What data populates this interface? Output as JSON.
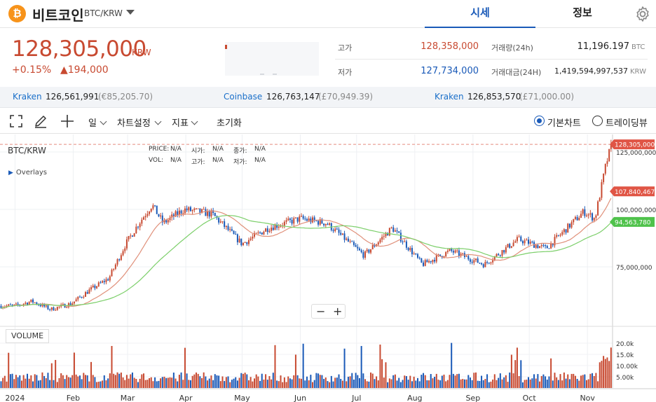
{
  "header": {
    "coin_icon": "₿",
    "coin_name": "비트코인",
    "pair": "BTC/KRW",
    "tabs": [
      {
        "label": "시세",
        "active": true
      },
      {
        "label": "정보",
        "active": false
      }
    ]
  },
  "summary": {
    "price": "128,305,000",
    "unit": "KRW",
    "change_pct": "+0.15%",
    "change_abs": "▲194,000",
    "high_label": "고가",
    "high_value": "128,358,000",
    "low_label": "저가",
    "low_value": "127,734,000",
    "volume_label": "거래량(24h)",
    "volume_value": "11,196.197",
    "volume_unit": "BTC",
    "amount_label": "거래대금(24H)",
    "amount_value": "1,419,594,997,537",
    "amount_unit": "KRW"
  },
  "exchanges": [
    {
      "name": "Kraken",
      "price": "126,561,991",
      "ref": "(€85,205.70)"
    },
    {
      "name": "Coinbase",
      "price": "126,763,147",
      "ref": "(£70,949.39)"
    },
    {
      "name": "Kraken",
      "price": "126,853,570",
      "ref": "(£71,000.00)"
    }
  ],
  "toolbar": {
    "interval": "일",
    "chart_settings": "차트설정",
    "indicators": "지표",
    "reset": "초기화",
    "basic_chart": "기본차트",
    "tradingview": "트레이딩뷰"
  },
  "chart_info": {
    "symbol": "BTC/KRW",
    "overlays": "Overlays",
    "price_lbl": "PRICE:",
    "price_val": "N/A",
    "open_lbl": "시가:",
    "open_val": "N/A",
    "close_lbl": "종가:",
    "close_val": "N/A",
    "vol_lbl": "VOL:",
    "vol_val": "N/A",
    "high_lbl": "고가:",
    "high_val": "N/A",
    "low_lbl": "저가:",
    "low_val": "N/A",
    "zoom_out": "−",
    "zoom_in": "+",
    "volume_title": "VOLUME"
  },
  "colors": {
    "up": "#c84a31",
    "down": "#1a5ab8",
    "ma_short": "#e0907a",
    "ma_long": "#7ccf6a",
    "active_tab": "#1a5ab8"
  },
  "chart_data": {
    "type": "candlestick",
    "series_description": "BTC/KRW daily candles with two moving averages and volume",
    "x_tick_labels": [
      "2024",
      "Feb",
      "Mar",
      "Apr",
      "May",
      "Jun",
      "Jul",
      "Aug",
      "Sep",
      "Oct",
      "Nov"
    ],
    "y_tick_labels": [
      "125,000,000",
      "100,000,000",
      "75,000,000"
    ],
    "ylim": [
      40000000,
      130000000
    ],
    "volume_tick_labels": [
      "20.0k",
      "15.0k",
      "10.00k",
      "5.00k"
    ],
    "volume_ylim": [
      0,
      25000
    ],
    "price_tags": [
      {
        "label": "128,305,000",
        "value": 128305000,
        "color": "#e05545"
      },
      {
        "label": "107,840,467",
        "value": 107840467,
        "color": "#e05545"
      },
      {
        "label": "94,563,780",
        "value": 94563780,
        "color": "#4fc24b"
      }
    ],
    "close_anchors": [
      {
        "date": "2024-01-01",
        "close": 58000000
      },
      {
        "date": "2024-01-10",
        "close": 60000000
      },
      {
        "date": "2024-01-20",
        "close": 56500000
      },
      {
        "date": "2024-01-31",
        "close": 59000000
      },
      {
        "date": "2024-02-10",
        "close": 65000000
      },
      {
        "date": "2024-02-20",
        "close": 70000000
      },
      {
        "date": "2024-02-29",
        "close": 85000000
      },
      {
        "date": "2024-03-07",
        "close": 94000000
      },
      {
        "date": "2024-03-14",
        "close": 102000000
      },
      {
        "date": "2024-03-20",
        "close": 94000000
      },
      {
        "date": "2024-03-31",
        "close": 100000000
      },
      {
        "date": "2024-04-15",
        "close": 98000000
      },
      {
        "date": "2024-05-01",
        "close": 85000000
      },
      {
        "date": "2024-05-15",
        "close": 92000000
      },
      {
        "date": "2024-06-01",
        "close": 96000000
      },
      {
        "date": "2024-06-15",
        "close": 94000000
      },
      {
        "date": "2024-07-05",
        "close": 80000000
      },
      {
        "date": "2024-07-20",
        "close": 92000000
      },
      {
        "date": "2024-08-05",
        "close": 76000000
      },
      {
        "date": "2024-08-20",
        "close": 82000000
      },
      {
        "date": "2024-09-07",
        "close": 76000000
      },
      {
        "date": "2024-09-25",
        "close": 87000000
      },
      {
        "date": "2024-10-10",
        "close": 83000000
      },
      {
        "date": "2024-10-30",
        "close": 99000000
      },
      {
        "date": "2024-11-05",
        "close": 96000000
      },
      {
        "date": "2024-11-11",
        "close": 120000000
      },
      {
        "date": "2024-11-14",
        "close": 128305000
      }
    ]
  }
}
